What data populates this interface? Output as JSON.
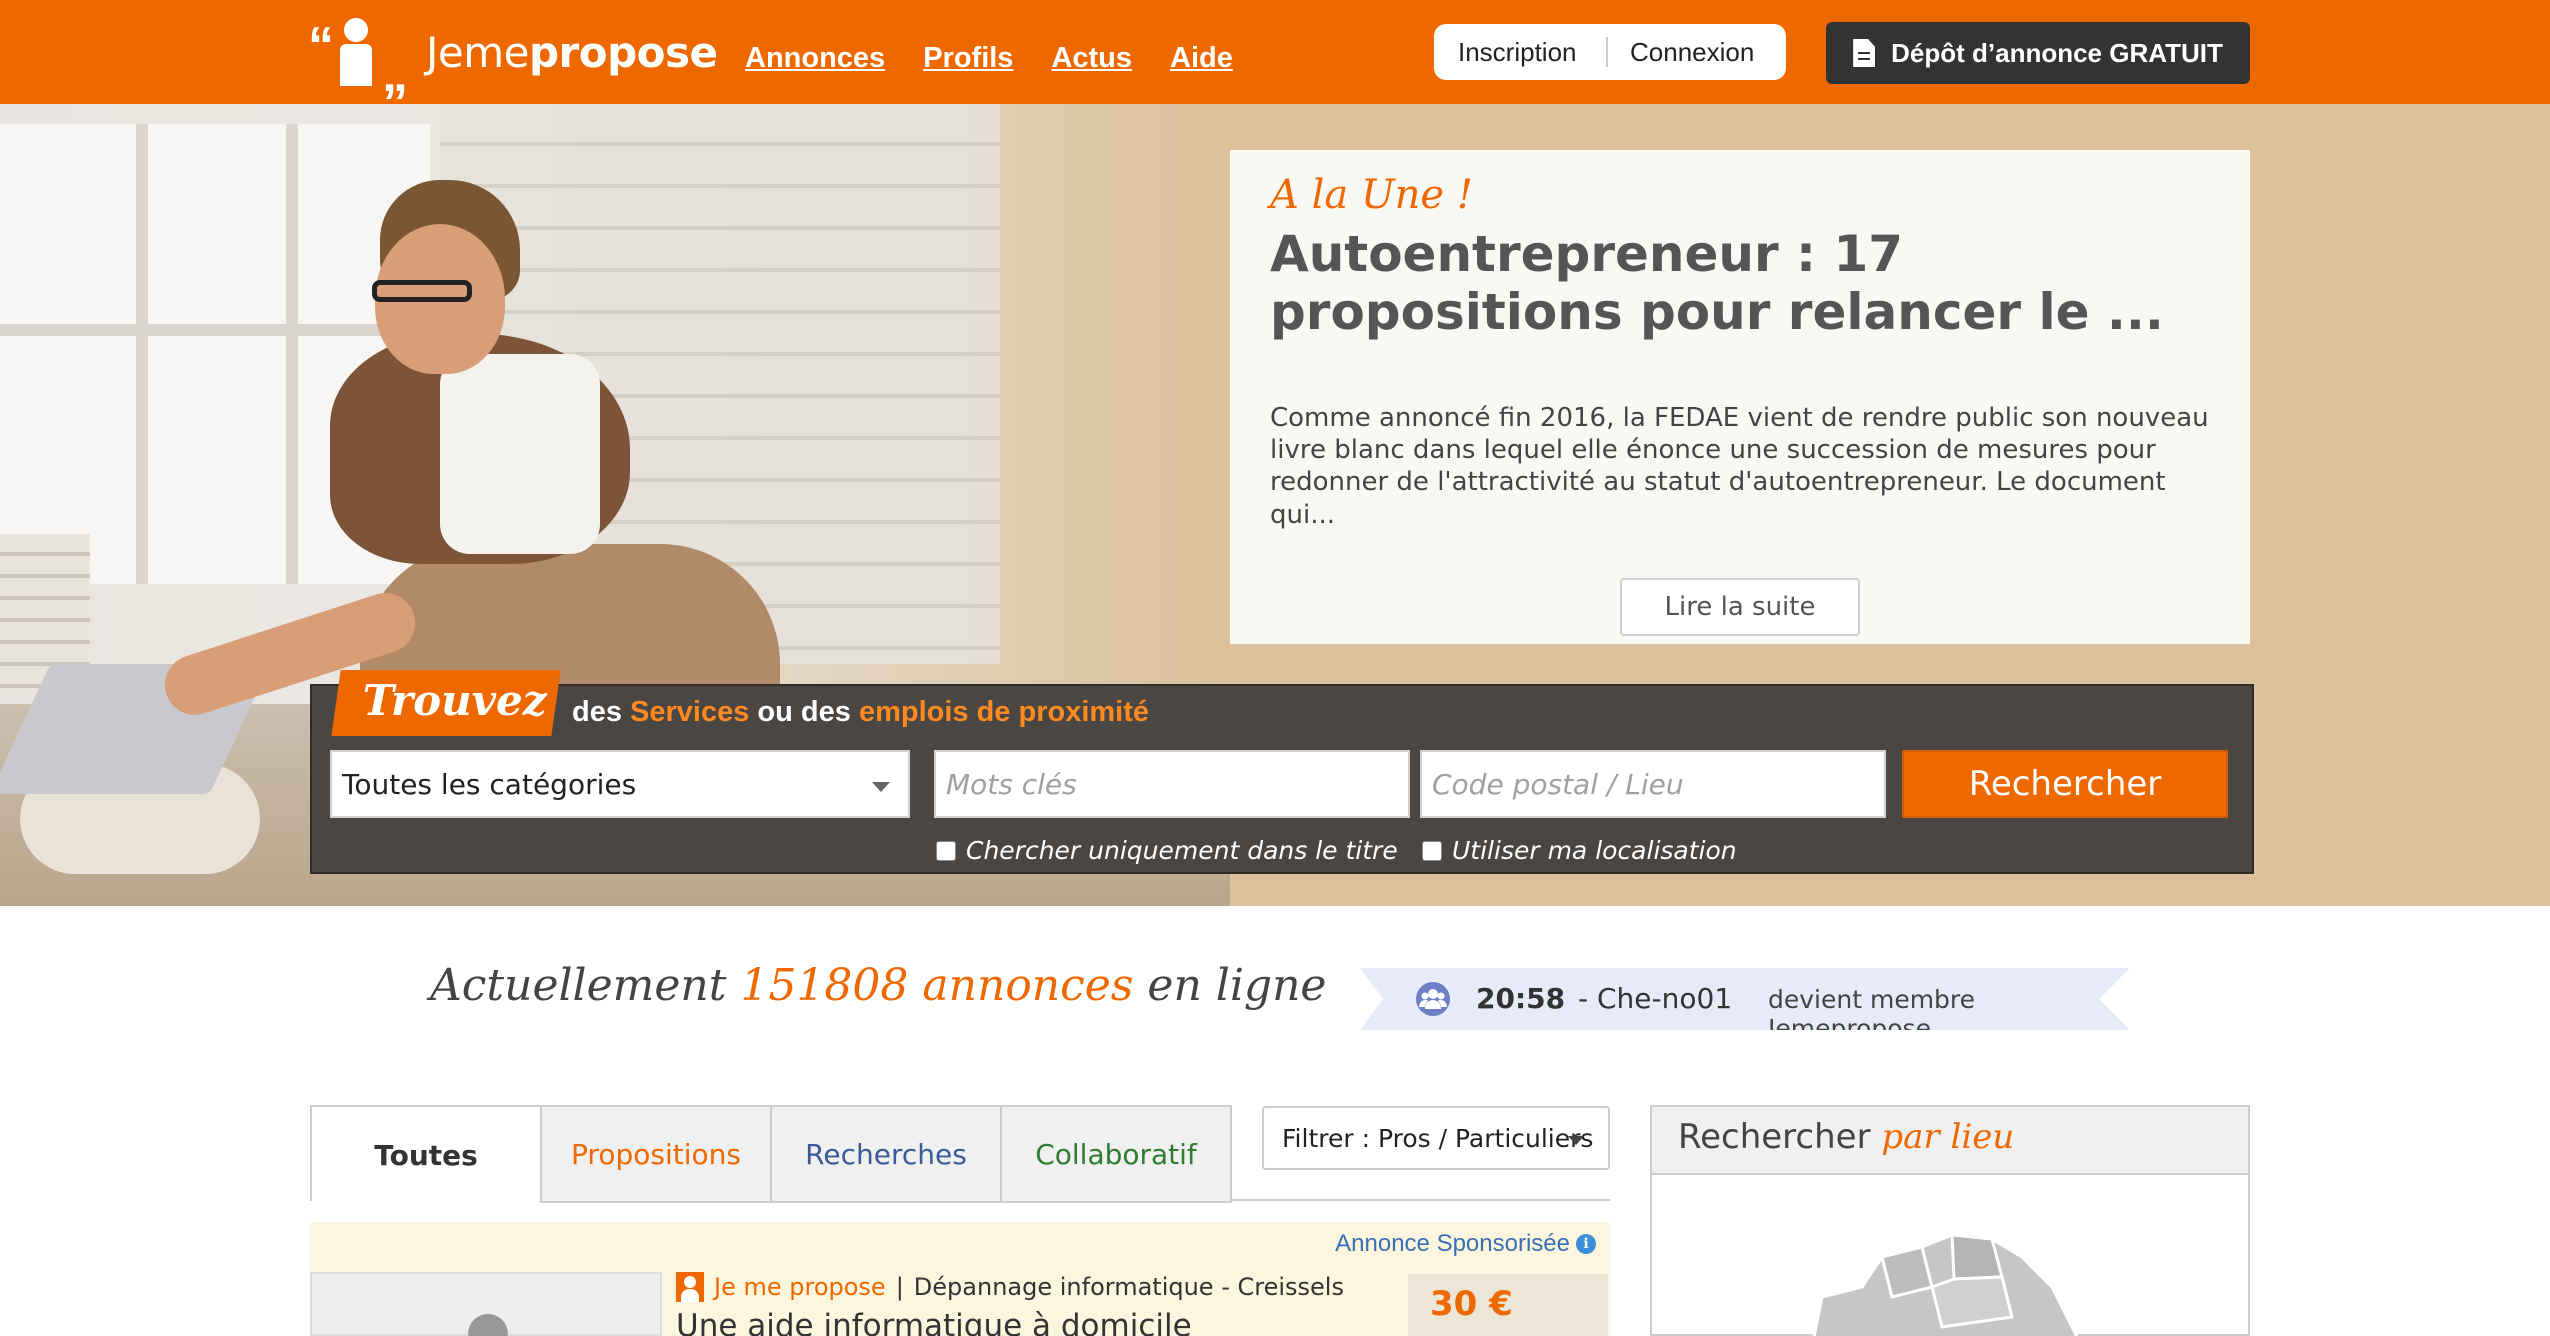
{
  "header": {
    "logo_text_light": "Jeme",
    "logo_text_bold": "propose",
    "nav": [
      "Annonces",
      "Profils",
      "Actus",
      "Aide"
    ],
    "signup": "Inscription",
    "login": "Connexion",
    "post_ad": "Dépôt d’annonce GRATUIT",
    "post_ad_icon": "document-icon",
    "brand_color": "#ee6800"
  },
  "feature": {
    "kicker": "A la Une !",
    "title": "Autoentrepreneur : 17 propositions pour relancer le ...",
    "excerpt": "Comme annoncé fin 2016, la FEDAE vient de rendre public son nouveau livre blanc dans lequel elle énonce une succession de mesures pour redonner de l'attractivité au statut d'autoentrepreneur. Le document qui...",
    "read_more": "Lire la suite"
  },
  "search": {
    "badge": "Trouvez",
    "tagline_1": "des ",
    "tagline_2": "Services",
    "tagline_3": " ou des ",
    "tagline_4": "emplois de proximité",
    "category_value": "Toutes les catégories",
    "keywords_placeholder": "Mots clés",
    "location_placeholder": "Code postal / Lieu",
    "submit": "Rechercher",
    "title_only_label": "Chercher uniquement dans le titre",
    "use_location_label": "Utiliser ma localisation"
  },
  "counter": {
    "prefix": "Actuellement",
    "count": "151808 annonces",
    "suffix": "en ligne"
  },
  "ticker": {
    "time": "20:58",
    "user": "- Che-no01",
    "message": "devient membre Jemepropose",
    "icon": "users-icon"
  },
  "tabs": [
    "Toutes",
    "Propositions",
    "Recherches",
    "Collaboratif"
  ],
  "filter": {
    "label": "Filtrer : Pros / Particuliers"
  },
  "listing": {
    "sponsored": "Annonce Sponsorisée",
    "source": "Je me propose",
    "separator": "|",
    "category": "Dépannage informatique - Creissels",
    "title": "Une aide informatique à domicile",
    "price": "30 €"
  },
  "sidebar": {
    "title_1": "Rechercher ",
    "title_2": "par lieu"
  }
}
